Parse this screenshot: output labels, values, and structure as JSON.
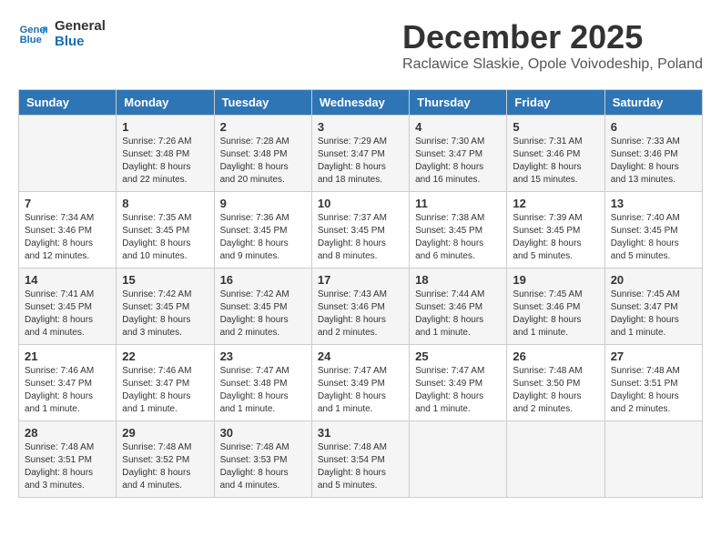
{
  "header": {
    "logo_line1": "General",
    "logo_line2": "Blue",
    "month_title": "December 2025",
    "location": "Raclawice Slaskie, Opole Voivodeship, Poland"
  },
  "days_of_week": [
    "Sunday",
    "Monday",
    "Tuesday",
    "Wednesday",
    "Thursday",
    "Friday",
    "Saturday"
  ],
  "weeks": [
    [
      {
        "day": "",
        "info": ""
      },
      {
        "day": "1",
        "info": "Sunrise: 7:26 AM\nSunset: 3:48 PM\nDaylight: 8 hours\nand 22 minutes."
      },
      {
        "day": "2",
        "info": "Sunrise: 7:28 AM\nSunset: 3:48 PM\nDaylight: 8 hours\nand 20 minutes."
      },
      {
        "day": "3",
        "info": "Sunrise: 7:29 AM\nSunset: 3:47 PM\nDaylight: 8 hours\nand 18 minutes."
      },
      {
        "day": "4",
        "info": "Sunrise: 7:30 AM\nSunset: 3:47 PM\nDaylight: 8 hours\nand 16 minutes."
      },
      {
        "day": "5",
        "info": "Sunrise: 7:31 AM\nSunset: 3:46 PM\nDaylight: 8 hours\nand 15 minutes."
      },
      {
        "day": "6",
        "info": "Sunrise: 7:33 AM\nSunset: 3:46 PM\nDaylight: 8 hours\nand 13 minutes."
      }
    ],
    [
      {
        "day": "7",
        "info": "Sunrise: 7:34 AM\nSunset: 3:46 PM\nDaylight: 8 hours\nand 12 minutes."
      },
      {
        "day": "8",
        "info": "Sunrise: 7:35 AM\nSunset: 3:45 PM\nDaylight: 8 hours\nand 10 minutes."
      },
      {
        "day": "9",
        "info": "Sunrise: 7:36 AM\nSunset: 3:45 PM\nDaylight: 8 hours\nand 9 minutes."
      },
      {
        "day": "10",
        "info": "Sunrise: 7:37 AM\nSunset: 3:45 PM\nDaylight: 8 hours\nand 8 minutes."
      },
      {
        "day": "11",
        "info": "Sunrise: 7:38 AM\nSunset: 3:45 PM\nDaylight: 8 hours\nand 6 minutes."
      },
      {
        "day": "12",
        "info": "Sunrise: 7:39 AM\nSunset: 3:45 PM\nDaylight: 8 hours\nand 5 minutes."
      },
      {
        "day": "13",
        "info": "Sunrise: 7:40 AM\nSunset: 3:45 PM\nDaylight: 8 hours\nand 5 minutes."
      }
    ],
    [
      {
        "day": "14",
        "info": "Sunrise: 7:41 AM\nSunset: 3:45 PM\nDaylight: 8 hours\nand 4 minutes."
      },
      {
        "day": "15",
        "info": "Sunrise: 7:42 AM\nSunset: 3:45 PM\nDaylight: 8 hours\nand 3 minutes."
      },
      {
        "day": "16",
        "info": "Sunrise: 7:42 AM\nSunset: 3:45 PM\nDaylight: 8 hours\nand 2 minutes."
      },
      {
        "day": "17",
        "info": "Sunrise: 7:43 AM\nSunset: 3:46 PM\nDaylight: 8 hours\nand 2 minutes."
      },
      {
        "day": "18",
        "info": "Sunrise: 7:44 AM\nSunset: 3:46 PM\nDaylight: 8 hours\nand 1 minute."
      },
      {
        "day": "19",
        "info": "Sunrise: 7:45 AM\nSunset: 3:46 PM\nDaylight: 8 hours\nand 1 minute."
      },
      {
        "day": "20",
        "info": "Sunrise: 7:45 AM\nSunset: 3:47 PM\nDaylight: 8 hours\nand 1 minute."
      }
    ],
    [
      {
        "day": "21",
        "info": "Sunrise: 7:46 AM\nSunset: 3:47 PM\nDaylight: 8 hours\nand 1 minute."
      },
      {
        "day": "22",
        "info": "Sunrise: 7:46 AM\nSunset: 3:47 PM\nDaylight: 8 hours\nand 1 minute."
      },
      {
        "day": "23",
        "info": "Sunrise: 7:47 AM\nSunset: 3:48 PM\nDaylight: 8 hours\nand 1 minute."
      },
      {
        "day": "24",
        "info": "Sunrise: 7:47 AM\nSunset: 3:49 PM\nDaylight: 8 hours\nand 1 minute."
      },
      {
        "day": "25",
        "info": "Sunrise: 7:47 AM\nSunset: 3:49 PM\nDaylight: 8 hours\nand 1 minute."
      },
      {
        "day": "26",
        "info": "Sunrise: 7:48 AM\nSunset: 3:50 PM\nDaylight: 8 hours\nand 2 minutes."
      },
      {
        "day": "27",
        "info": "Sunrise: 7:48 AM\nSunset: 3:51 PM\nDaylight: 8 hours\nand 2 minutes."
      }
    ],
    [
      {
        "day": "28",
        "info": "Sunrise: 7:48 AM\nSunset: 3:51 PM\nDaylight: 8 hours\nand 3 minutes."
      },
      {
        "day": "29",
        "info": "Sunrise: 7:48 AM\nSunset: 3:52 PM\nDaylight: 8 hours\nand 4 minutes."
      },
      {
        "day": "30",
        "info": "Sunrise: 7:48 AM\nSunset: 3:53 PM\nDaylight: 8 hours\nand 4 minutes."
      },
      {
        "day": "31",
        "info": "Sunrise: 7:48 AM\nSunset: 3:54 PM\nDaylight: 8 hours\nand 5 minutes."
      },
      {
        "day": "",
        "info": ""
      },
      {
        "day": "",
        "info": ""
      },
      {
        "day": "",
        "info": ""
      }
    ]
  ]
}
